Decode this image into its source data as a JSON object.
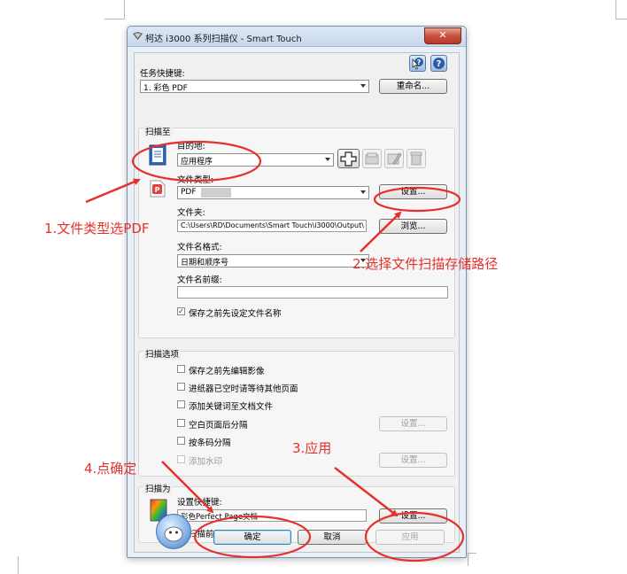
{
  "window": {
    "title": "柯达 i3000 系列扫描仪 - Smart Touch",
    "close_glyph": "✕"
  },
  "header": {
    "help_icons": [
      "help-cursor-icon",
      "help-question-icon"
    ]
  },
  "task": {
    "label": "任务快捷键:",
    "selected": "1. 彩色 PDF",
    "rename_button": "重命名..."
  },
  "scan_to": {
    "heading": "扫描至",
    "destination_label": "目的地:",
    "destination_value": "应用程序",
    "file_type_label": "文件类型:",
    "file_type_value": "PDF",
    "file_type_settings": "设置...",
    "folder_label": "文件夹:",
    "folder_path": "C:\\Users\\RD\\Documents\\Smart Touch\\i3000\\Output\\",
    "browse_button": "浏览...",
    "filename_format_label": "文件名格式:",
    "filename_format_value": "日期和顺序号",
    "filename_prefix_label": "文件名前缀:",
    "filename_prefix_value": "",
    "confirm_name": {
      "label": "保存之前先设定文件名称",
      "checked": true
    }
  },
  "scan_options": {
    "heading": "扫描选项",
    "items": [
      {
        "label": "保存之前先编辑影像",
        "checked": false,
        "disabled": false
      },
      {
        "label": "进纸器已空时请等待其他页面",
        "checked": false,
        "disabled": false
      },
      {
        "label": "添加关键词至文档文件",
        "checked": false,
        "disabled": false
      },
      {
        "label": "空白页面后分隔",
        "checked": false,
        "disabled": false
      },
      {
        "label": "按条码分隔",
        "checked": false,
        "disabled": false
      },
      {
        "label": "添加水印",
        "checked": false,
        "disabled": true
      }
    ],
    "blank_settings": "设置...",
    "watermark_settings": "设置..."
  },
  "scan_as": {
    "heading": "扫描为",
    "settings_label": "设置快捷键:",
    "settings_value": "彩色Perfect Page文档",
    "settings_button": "设置...",
    "show_settings": {
      "label": "扫描前显示设置",
      "checked": false
    }
  },
  "footer": {
    "ok": "确定",
    "cancel": "取消",
    "apply": "应用"
  },
  "annotations": {
    "step1": "1.文件类型选PDF",
    "step2": "2.选择文件扫描存储路径",
    "step3": "3.应用",
    "step4": "4.点确定",
    "color": "#e5312d"
  }
}
